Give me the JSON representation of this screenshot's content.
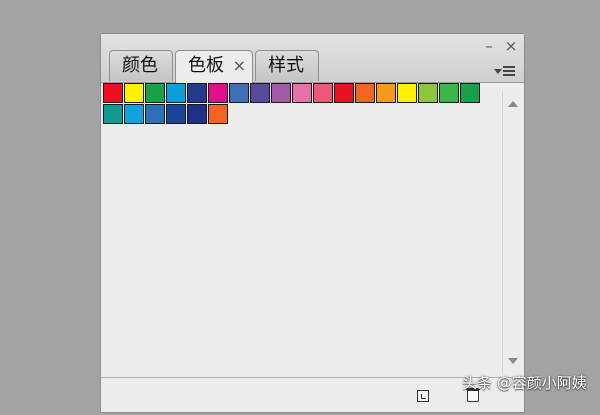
{
  "tabs": [
    {
      "label": "颜色",
      "active": false
    },
    {
      "label": "色板",
      "active": true
    },
    {
      "label": "样式",
      "active": false
    }
  ],
  "tab_close_glyph": "×",
  "window_minimize_glyph": "–",
  "window_close_glyph": "×",
  "swatches": [
    "#ee1020",
    "#fff200",
    "#1ca04a",
    "#0ba0dc",
    "#233a8e",
    "#e1108a",
    "#3f6fb5",
    "#5b4a9c",
    "#a55aa8",
    "#e673a8",
    "#e85a77",
    "#ec1023",
    "#f06522",
    "#f49c1a",
    "#fff200",
    "#8cc63f",
    "#39b54a",
    "#1aa04a",
    "#109a90",
    "#10a3de",
    "#2b70b9",
    "#1d449a",
    "#1e2f8c",
    "#f26522"
  ],
  "icons": {
    "menu": "panel-menu-icon",
    "scroll_up": "scroll-up-arrow-icon",
    "scroll_down": "scroll-down-arrow-icon",
    "new_swatch": "new-swatch-icon",
    "delete": "trash-icon"
  },
  "watermark": "头条 @容颜小阿姨"
}
